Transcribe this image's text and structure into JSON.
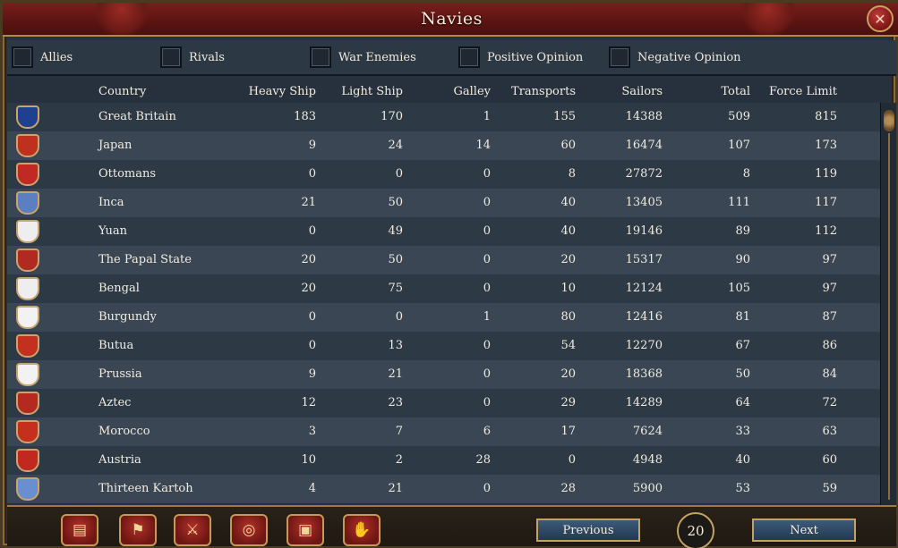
{
  "window": {
    "title": "Navies"
  },
  "filters": [
    {
      "label": "Allies"
    },
    {
      "label": "Rivals"
    },
    {
      "label": "War Enemies"
    },
    {
      "label": "Positive Opinion"
    },
    {
      "label": "Negative Opinion"
    }
  ],
  "columns": {
    "country": "Country",
    "heavy_ship": "Heavy Ship",
    "light_ship": "Light Ship",
    "galley": "Galley",
    "transports": "Transports",
    "sailors": "Sailors",
    "total": "Total",
    "force_limit": "Force Limit"
  },
  "rows": [
    {
      "country": "Great Britain",
      "heavy": "183",
      "light": "170",
      "galley": "1",
      "transports": "155",
      "sailors": "14388",
      "total": "509",
      "force": "815",
      "flag_color": "#1f3f8f"
    },
    {
      "country": "Japan",
      "heavy": "9",
      "light": "24",
      "galley": "14",
      "transports": "60",
      "sailors": "16474",
      "total": "107",
      "force": "173",
      "flag_color": "#c0301f"
    },
    {
      "country": "Ottomans",
      "heavy": "0",
      "light": "0",
      "galley": "0",
      "transports": "8",
      "sailors": "27872",
      "total": "8",
      "force": "119",
      "flag_color": "#c12a24"
    },
    {
      "country": "Inca",
      "heavy": "21",
      "light": "50",
      "galley": "0",
      "transports": "40",
      "sailors": "13405",
      "total": "111",
      "force": "117",
      "flag_color": "#5b7fc0"
    },
    {
      "country": "Yuan",
      "heavy": "0",
      "light": "49",
      "galley": "0",
      "transports": "40",
      "sailors": "19146",
      "total": "89",
      "force": "112",
      "flag_color": "#eeeeee"
    },
    {
      "country": "The Papal State",
      "heavy": "20",
      "light": "50",
      "galley": "0",
      "transports": "20",
      "sailors": "15317",
      "total": "90",
      "force": "97",
      "flag_color": "#b02a22"
    },
    {
      "country": "Bengal",
      "heavy": "20",
      "light": "75",
      "galley": "0",
      "transports": "10",
      "sailors": "12124",
      "total": "105",
      "force": "97",
      "flag_color": "#eeeeee"
    },
    {
      "country": "Burgundy",
      "heavy": "0",
      "light": "0",
      "galley": "1",
      "transports": "80",
      "sailors": "12416",
      "total": "81",
      "force": "87",
      "flag_color": "#f2f2f2"
    },
    {
      "country": "Butua",
      "heavy": "0",
      "light": "13",
      "galley": "0",
      "transports": "54",
      "sailors": "12270",
      "total": "67",
      "force": "86",
      "flag_color": "#c3301f"
    },
    {
      "country": "Prussia",
      "heavy": "9",
      "light": "21",
      "galley": "0",
      "transports": "20",
      "sailors": "18368",
      "total": "50",
      "force": "84",
      "flag_color": "#f2f2f2"
    },
    {
      "country": "Aztec",
      "heavy": "12",
      "light": "23",
      "galley": "0",
      "transports": "29",
      "sailors": "14289",
      "total": "64",
      "force": "72",
      "flag_color": "#b52a20"
    },
    {
      "country": "Morocco",
      "heavy": "3",
      "light": "7",
      "galley": "6",
      "transports": "17",
      "sailors": "7624",
      "total": "33",
      "force": "63",
      "flag_color": "#c4301c"
    },
    {
      "country": "Austria",
      "heavy": "10",
      "light": "2",
      "galley": "28",
      "transports": "0",
      "sailors": "4948",
      "total": "40",
      "force": "60",
      "flag_color": "#c1281f"
    },
    {
      "country": "Thirteen Kartoh",
      "heavy": "4",
      "light": "21",
      "galley": "0",
      "transports": "28",
      "sailors": "5900",
      "total": "53",
      "force": "59",
      "flag_color": "#6a8fd0"
    }
  ],
  "pagination": {
    "previous": "Previous",
    "next": "Next",
    "count": "20"
  },
  "bottom_icons": [
    "ledger-icon",
    "flag-icon",
    "crossed-swords-icon",
    "coins-icon",
    "trade-goods-icon",
    "handshake-icon"
  ]
}
